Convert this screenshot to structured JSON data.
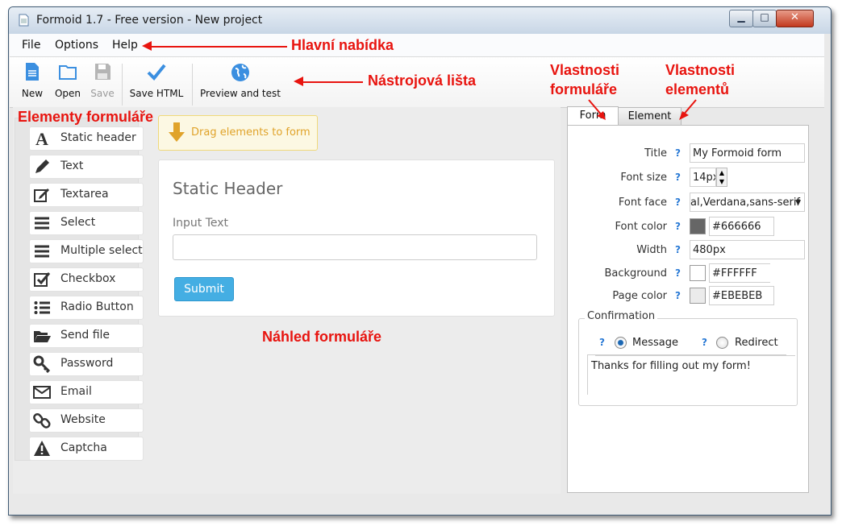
{
  "window": {
    "title": "Formoid 1.7 - Free version - New project"
  },
  "menu": [
    "File",
    "Options",
    "Help"
  ],
  "toolbar": {
    "new": "New",
    "open": "Open",
    "save": "Save",
    "save_html": "Save HTML",
    "preview": "Preview and test"
  },
  "elements": [
    {
      "label": "Static header",
      "icon": "letter-a-icon"
    },
    {
      "label": "Text",
      "icon": "pencil-icon"
    },
    {
      "label": "Textarea",
      "icon": "edit-box-icon"
    },
    {
      "label": "Select",
      "icon": "lines-icon"
    },
    {
      "label": "Multiple select",
      "icon": "lines-icon"
    },
    {
      "label": "Checkbox",
      "icon": "checkbox-icon"
    },
    {
      "label": "Radio Button",
      "icon": "list-bullets-icon"
    },
    {
      "label": "Send file",
      "icon": "folder-open-icon"
    },
    {
      "label": "Password",
      "icon": "key-icon"
    },
    {
      "label": "Email",
      "icon": "envelope-icon"
    },
    {
      "label": "Website",
      "icon": "link-icon"
    },
    {
      "label": "Captcha",
      "icon": "warning-icon"
    }
  ],
  "canvas": {
    "drop_hint": "Drag elements to form",
    "header": "Static Header",
    "input_label": "Input Text",
    "submit": "Submit"
  },
  "tabs": {
    "form": "Form",
    "element": "Element"
  },
  "properties": {
    "title_label": "Title",
    "title_value": "My Formoid form",
    "font_size_label": "Font size",
    "font_size_value": "14px",
    "font_face_label": "Font face",
    "font_face_value": "al,Verdana,sans-serif",
    "font_color_label": "Font color",
    "font_color_value": "#666666",
    "width_label": "Width",
    "width_value": "480px",
    "background_label": "Background",
    "background_value": "#FFFFFF",
    "page_color_label": "Page color",
    "page_color_value": "#EBEBEB",
    "help": "?"
  },
  "confirmation": {
    "legend": "Confirmation",
    "message": "Message",
    "redirect": "Redirect",
    "text": "Thanks for filling out my form!"
  },
  "annotations": {
    "main_menu": "Hlavní nabídka",
    "toolbar": "Nástrojová lišta",
    "form_props_1": "Vlastnosti",
    "form_props_2": "formuláře",
    "element_props_1": "Vlastnosti",
    "element_props_2": "elementů",
    "form_elements": "Elementy formuláře",
    "form_preview": "Náhled formuláře"
  },
  "colors": {
    "accent": "#44aee3",
    "annotation": "#e8140f",
    "font_color_swatch": "#666666",
    "background_swatch": "#FFFFFF",
    "page_color_swatch": "#EBEBEB"
  }
}
